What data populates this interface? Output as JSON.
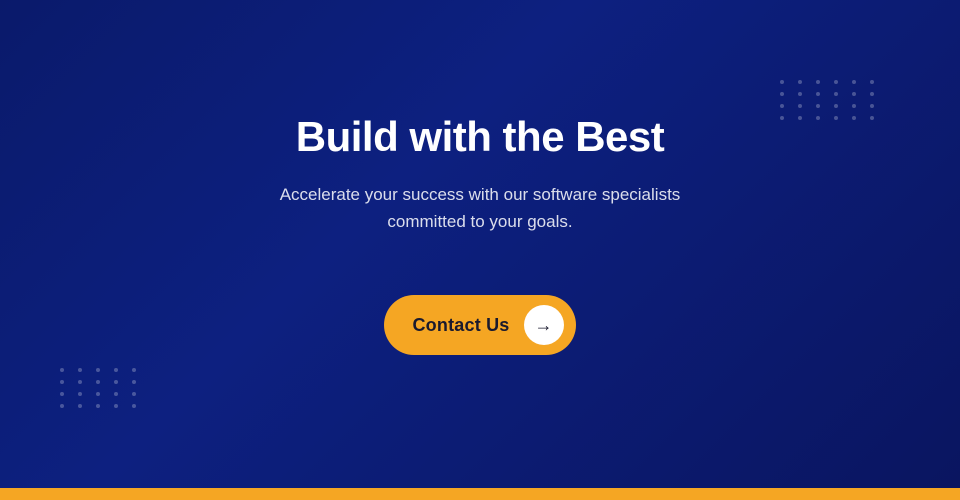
{
  "hero": {
    "title": "Build with the Best",
    "subtitle": "Accelerate your success with our software specialists committed to your goals.",
    "cta": {
      "label": "Contact Us",
      "arrow": "→"
    }
  },
  "colors": {
    "background_start": "#0a1a6b",
    "background_end": "#0a1560",
    "accent": "#f5a623",
    "text_primary": "#ffffff",
    "text_secondary": "rgba(255,255,255,0.85)",
    "bottom_bar": "#f5a623"
  },
  "dots": {
    "top_right_rows": 4,
    "top_right_cols": 6,
    "bottom_left_rows": 4,
    "bottom_left_cols": 5
  }
}
